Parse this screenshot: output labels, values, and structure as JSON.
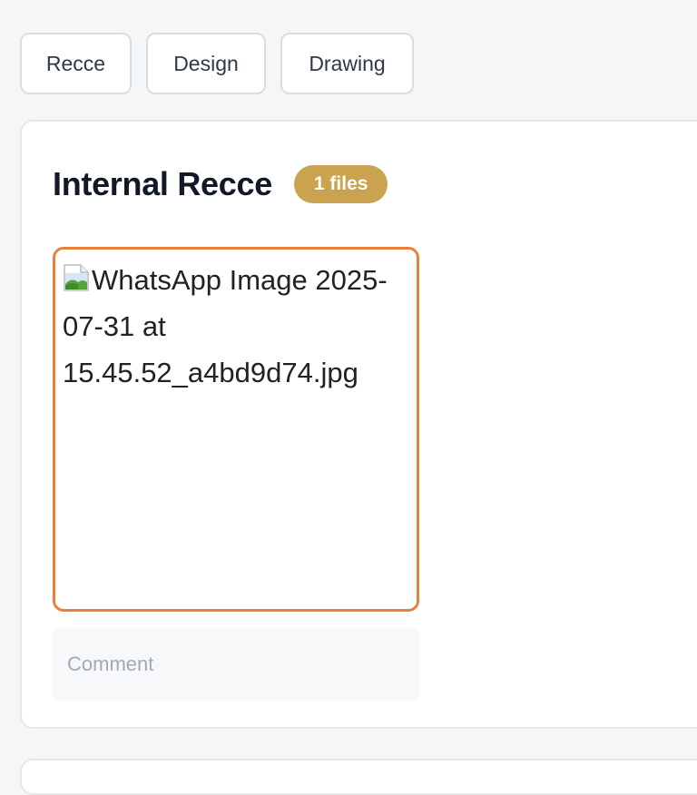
{
  "tabs": [
    {
      "label": "Recce"
    },
    {
      "label": "Design"
    },
    {
      "label": "Drawing"
    }
  ],
  "section": {
    "title": "Internal Recce",
    "badge": "1 files"
  },
  "file": {
    "alt_text": "WhatsApp Image 2025-07-31 at 15.45.52_a4bd9d74.jpg",
    "icon": "broken-image-icon"
  },
  "comment": {
    "placeholder": "Comment",
    "value": ""
  },
  "colors": {
    "accent_border": "#e9803a",
    "badge_bg": "#cba250"
  }
}
